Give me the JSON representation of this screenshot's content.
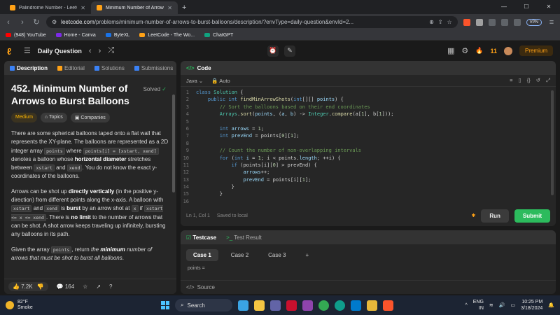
{
  "browser": {
    "tabs": [
      {
        "title": "Palindrome Number - LeetCode",
        "active": false
      },
      {
        "title": "Minimum Number of Arrows to Burst Balloons",
        "active": true
      }
    ],
    "url_host": "leetcode.com",
    "url_path": "/problems/minimum-number-of-arrows-to-burst-balloons/description/?envType=daily-question&envId=2...",
    "vpn_label": "VPN",
    "bookmarks": [
      {
        "label": "(948) YouTube",
        "color": "#ff0000"
      },
      {
        "label": "Home - Canva",
        "color": "#7d2ae8"
      },
      {
        "label": "ByteXL",
        "color": "#1a73e8"
      },
      {
        "label": "LeetCode - The Wo...",
        "color": "#ffa116"
      },
      {
        "label": "ChatGPT",
        "color": "#10a37f"
      }
    ]
  },
  "header": {
    "section": "Daily Question",
    "streak": "11",
    "premium_label": "Premium"
  },
  "problem": {
    "tabs": [
      "Description",
      "Editorial",
      "Solutions",
      "Submissions"
    ],
    "title": "452. Minimum Number of Arrows to Burst Balloons",
    "status": "Solved",
    "badges": [
      "Medium",
      "Topics",
      "Companies"
    ],
    "p1_a": "There are some spherical balloons taped onto a flat wall that represents the XY-plane. The balloons are represented as a 2D integer array ",
    "p1_code1": "points",
    "p1_b": " where ",
    "p1_code2": "points[i] = [xstart, xend]",
    "p1_c": " denotes a balloon whose ",
    "p1_bold": "horizontal diameter",
    "p1_d": " stretches between ",
    "p1_code3": "xstart",
    "p1_e": " and ",
    "p1_code4": "xend",
    "p1_f": ". You do not know the exact y-coordinates of the balloons.",
    "p2_a": "Arrows can be shot up ",
    "p2_bold1": "directly vertically",
    "p2_b": " (in the positive y-direction) from different points along the x-axis. A balloon with ",
    "p2_code1": "xstart",
    "p2_c": " and ",
    "p2_code2": "xend",
    "p2_d": " is ",
    "p2_bold2": "burst",
    "p2_e": " by an arrow shot at ",
    "p2_code3": "x",
    "p2_f": " if ",
    "p2_code4": "xstart <= x <= xend",
    "p2_g": ". There is ",
    "p2_bold3": "no limit",
    "p2_h": " to the number of arrows that can be shot. A shot arrow keeps traveling up infinitely, bursting any balloons in its path.",
    "p3_a": "Given the array ",
    "p3_code": "points",
    "p3_b": ", return ",
    "p3_em1": "the ",
    "p3_bold": "minimum",
    "p3_em2": " number of arrows that must be shot to burst all balloons",
    "p3_c": ".",
    "likes": "7.2K",
    "comments": "164"
  },
  "editor": {
    "panel_title": "Code",
    "language": "Java",
    "mode": "Auto",
    "status": "Ln 1, Col 1",
    "saved": "Saved to local",
    "run_label": "Run",
    "submit_label": "Submit"
  },
  "testcase": {
    "tab_active": "Testcase",
    "tab_other": "Test Result",
    "cases": [
      "Case 1",
      "Case 2",
      "Case 3"
    ],
    "input_label": "points =",
    "source_label": "Source"
  },
  "taskbar": {
    "temp": "82°F",
    "weather": "Smoke",
    "search_placeholder": "Search",
    "lang_1": "ENG",
    "lang_2": "IN",
    "time": "10:25 PM",
    "date": "3/18/2024"
  }
}
